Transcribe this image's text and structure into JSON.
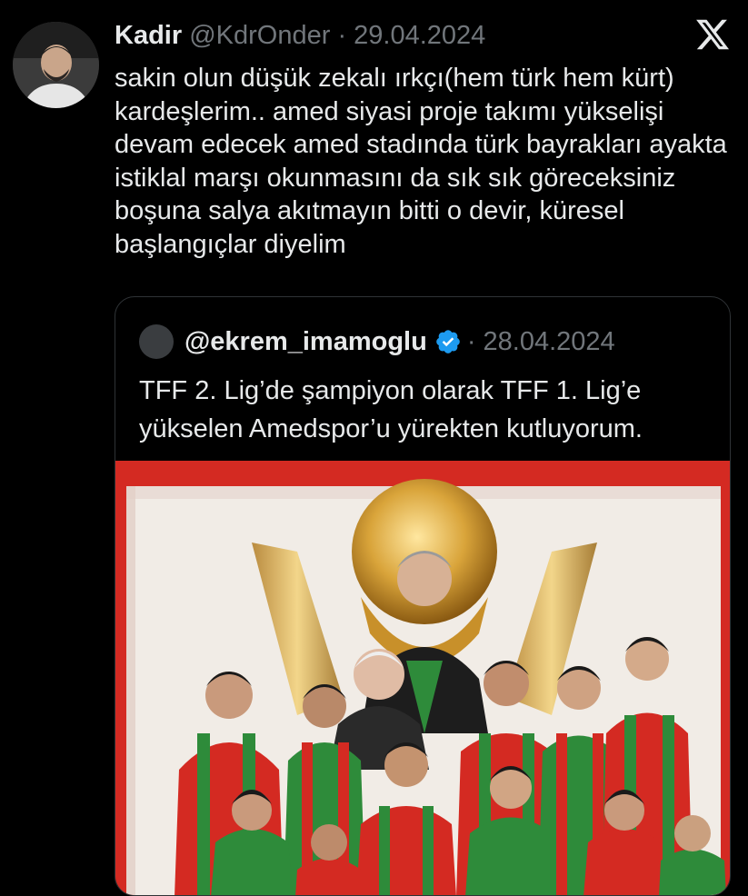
{
  "tweet": {
    "author_name": "Kadir",
    "author_handle": "@KdrOnder",
    "separator": "·",
    "date": "29.04.2024",
    "text": "sakin olun düşük zekalı ırkçı(hem türk hem kürt) kardeşlerim.. amed siyasi proje takımı yükselişi devam edecek amed stadında türk bayrakları ayakta istiklal marşı okunmasını da sık sık göreceksiniz boşuna salya akıtmayın bitti o devir, küresel başlangıçlar diyelim"
  },
  "quoted": {
    "handle": "@ekrem_imamoglu",
    "separator": "·",
    "date": "28.04.2024",
    "text": "TFF 2. Lig’de şampiyon olarak TFF 1. Lig’e yükselen Amedspor’u yürekten kutluyorum."
  },
  "icons": {
    "brand": "x-logo-icon",
    "verified": "verified-badge-icon"
  },
  "colors": {
    "background": "#000000",
    "text": "#e7e9ea",
    "muted": "#71767b",
    "border": "#2f3336",
    "verified": "#1d9bf0",
    "jersey_red": "#d42a22",
    "jersey_green": "#2e8b3a"
  }
}
